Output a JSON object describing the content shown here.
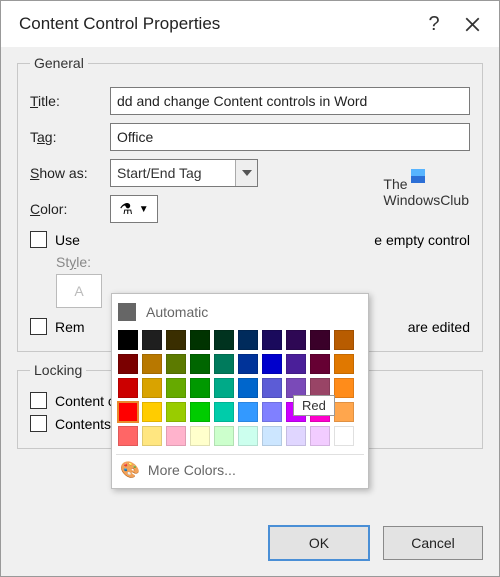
{
  "titlebar": {
    "title": "Content Control Properties"
  },
  "general": {
    "legend": "General",
    "title_label": "Title:",
    "title_value": "dd and change Content controls in Word",
    "tag_label": "Tag:",
    "tag_value": "Office",
    "showas_label": "Show as:",
    "showas_value": "Start/End Tag",
    "color_label": "Color:",
    "use_style_label": "Use a style to format text typed into the empty control",
    "style_label": "Style:",
    "style_placeholder": "A",
    "remove_label": "Remove content control when contents are edited",
    "use_style_trunc": "Use",
    "remove_trunc": "Rem"
  },
  "locking": {
    "legend": "Locking",
    "no_delete": "Content control cannot be deleted",
    "no_edit": "Contents cannot be edited"
  },
  "buttons": {
    "ok": "OK",
    "cancel": "Cancel"
  },
  "watermark": {
    "line1": "The",
    "line2": "WindowsClub"
  },
  "picker": {
    "automatic": "Automatic",
    "more": "More Colors...",
    "tooltip": "Red",
    "colors": [
      "#000000",
      "#1f1f1f",
      "#3a2e00",
      "#003300",
      "#00331f",
      "#002b5c",
      "#1a0a5c",
      "#2e0854",
      "#3a0029",
      "#b85c00",
      "#7a0000",
      "#b87800",
      "#5c7a00",
      "#006600",
      "#007a5c",
      "#003399",
      "#0000cc",
      "#4a1f99",
      "#660033",
      "#e07800",
      "#cc0000",
      "#d9a300",
      "#66aa00",
      "#009900",
      "#00aa88",
      "#0066cc",
      "#5c5cd6",
      "#7a4ab8",
      "#994466",
      "#ff8c1a",
      "#ff0000",
      "#ffcc00",
      "#99cc00",
      "#00cc00",
      "#00ccaa",
      "#3399ff",
      "#8080ff",
      "#cc00ff",
      "#ff00cc",
      "#ffa64d",
      "#ff6666",
      "#ffe680",
      "#ffb3cc",
      "#ffffcc",
      "#ccffcc",
      "#ccffee",
      "#cce6ff",
      "#e0d6ff",
      "#f2ccff",
      "#ffffff"
    ],
    "selected_index": 30
  }
}
